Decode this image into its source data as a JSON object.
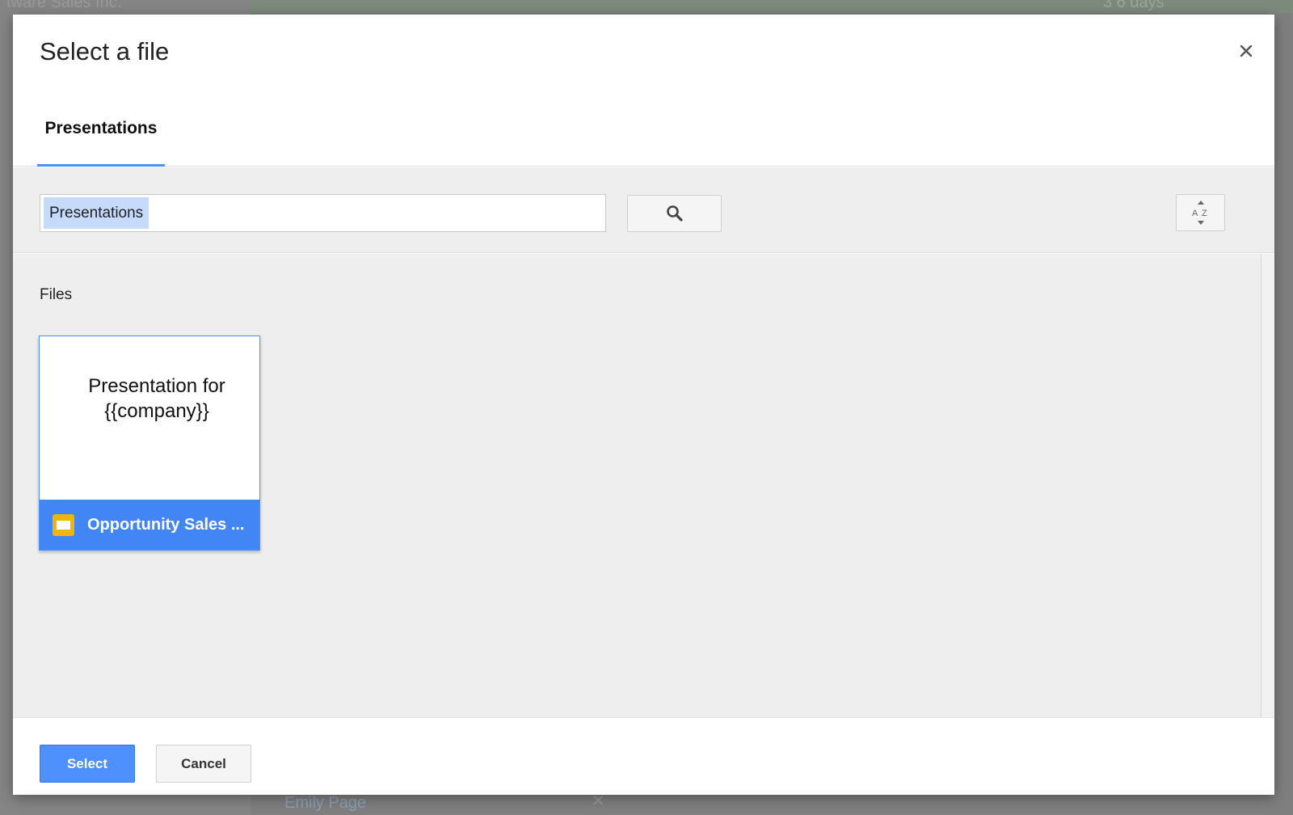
{
  "dialog": {
    "title": "Select a file",
    "close_icon": "close-icon"
  },
  "tabs": [
    {
      "label": "Presentations",
      "active": true
    }
  ],
  "search": {
    "value": "Presentations",
    "search_icon": "search-icon",
    "sort_icon": "sort-az-icon"
  },
  "files_section": {
    "label": "Files",
    "items": [
      {
        "thumbnail_text": "Presentation for {{company}}",
        "name": "Opportunity Sales ...",
        "icon": "slides-icon",
        "selected": true
      }
    ]
  },
  "footer": {
    "select_label": "Select",
    "cancel_label": "Cancel"
  },
  "background": {
    "top_left_text": "tware Sales Inc.",
    "top_right_text": "3 6 days",
    "bottom_name": "Emily Page"
  },
  "colors": {
    "accent": "#4d90fe",
    "selected_footer": "#4285f4",
    "slides_yellow": "#f4b400",
    "chip_highlight": "#c6dafc"
  }
}
